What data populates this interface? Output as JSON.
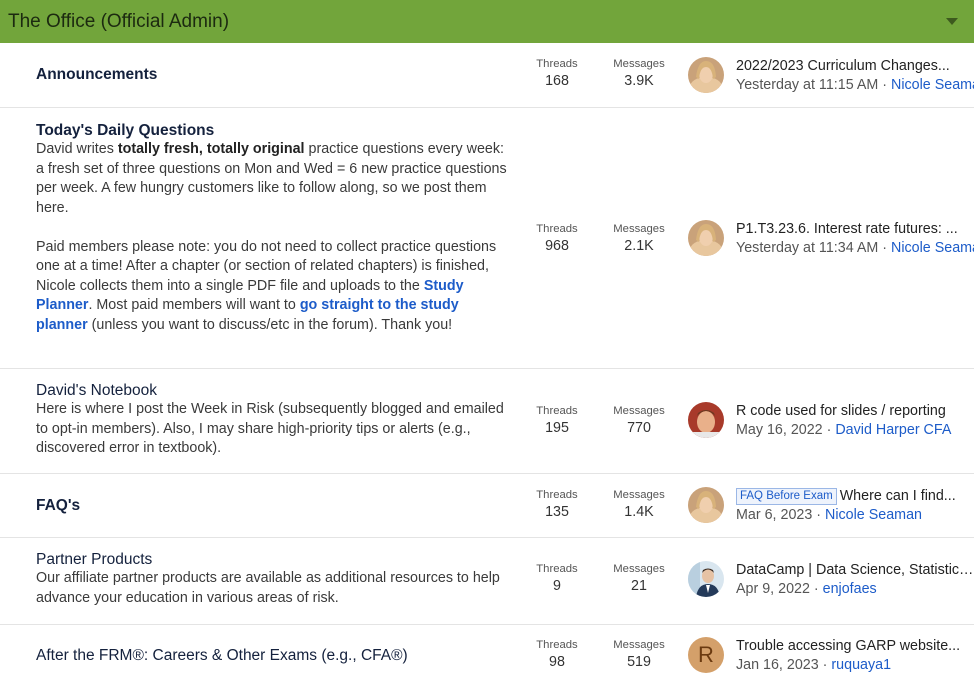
{
  "header": {
    "title": "The Office (Official Admin)"
  },
  "stat_labels": {
    "threads": "Threads",
    "messages": "Messages"
  },
  "nodes": [
    {
      "title": "Announcements",
      "threads": "168",
      "messages": "3.9K",
      "last_title": "2022/2023 Curriculum Changes...",
      "last_date": "Yesterday at 11:15 AM",
      "last_user": "Nicole Seaman",
      "avatar": "nicole-avatar"
    },
    {
      "title": "Today's Daily Questions",
      "desc": {
        "p1_a": "David writes ",
        "p1_b": "totally fresh, totally original",
        "p1_c": " practice questions every week: a fresh set of three questions on Mon and Wed = 6 new practice questions per week. A few hungry customers like to follow along, so we post them here.",
        "p2_a": "Paid members please note: you do not need to collect practice questions one at a time! After a chapter (or section of related chapters) is finished, Nicole collects them into a single PDF file and uploads to the ",
        "p2_link1": "Study Planner",
        "p2_b": ". Most paid members will want to ",
        "p2_link2": "go straight to the study planner",
        "p2_c": " (unless you want to discuss/etc in the forum). Thank you!"
      },
      "threads": "968",
      "messages": "2.1K",
      "last_title": "P1.T3.23.6. Interest rate futures: ...",
      "last_date": "Yesterday at 11:34 AM",
      "last_user": "Nicole Seaman",
      "avatar": "nicole-avatar"
    },
    {
      "title": "David's Notebook",
      "desc": "Here is where I post the Week in Risk (subsequently blogged and emailed to opt-in members). Also, I may share high-priority tips or alerts (e.g., discovered error in textbook).",
      "threads": "195",
      "messages": "770",
      "last_title": "R code used for slides / reporting",
      "last_date": "May 16, 2022",
      "last_user": "David Harper CFA",
      "avatar": "david-avatar"
    },
    {
      "title": "FAQ's",
      "threads": "135",
      "messages": "1.4K",
      "last_prefix": "FAQ Before Exam",
      "last_title": "Where can I find...",
      "last_date": "Mar 6, 2023",
      "last_user": "Nicole Seaman",
      "avatar": "nicole-avatar"
    },
    {
      "title": "Partner Products",
      "desc": "Our affiliate partner products are available as additional resources to help advance your education in various areas of risk.",
      "threads": "9",
      "messages": "21",
      "last_title": "DataCamp | Data Science, Statistics...",
      "last_date": "Apr 9, 2022",
      "last_user": "enjofaes",
      "avatar": "enjofaes-avatar"
    },
    {
      "title": "After the FRM®: Careers & Other Exams (e.g., CFA®)",
      "threads": "98",
      "messages": "519",
      "last_title": "Trouble accessing GARP website...",
      "last_date": "Jan 16, 2023",
      "last_user": "ruquaya1",
      "avatar_letter": "R"
    }
  ]
}
